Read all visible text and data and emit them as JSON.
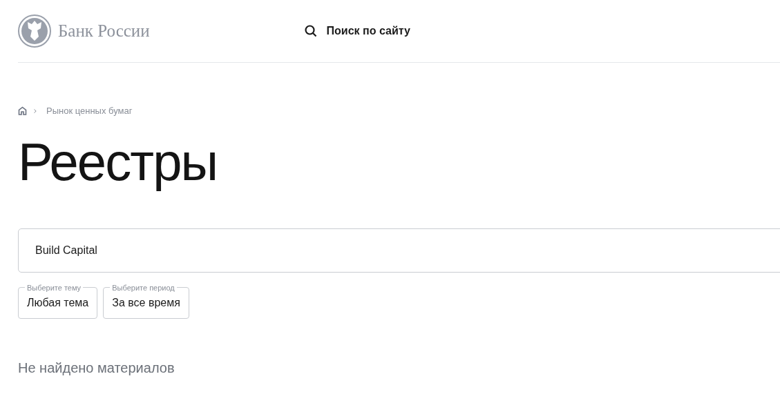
{
  "header": {
    "logo_text": "Банк России",
    "search_label": "Поиск по сайту"
  },
  "breadcrumb": [
    "Рынок ценных бумаг"
  ],
  "title": "Реестры",
  "search": {
    "value": "Build Capital"
  },
  "filters": [
    {
      "label": "Выберите тему",
      "value": "Любая тема"
    },
    {
      "label": "Выберите период",
      "value": "За все время"
    }
  ],
  "empty_message": "Не найдено материалов"
}
